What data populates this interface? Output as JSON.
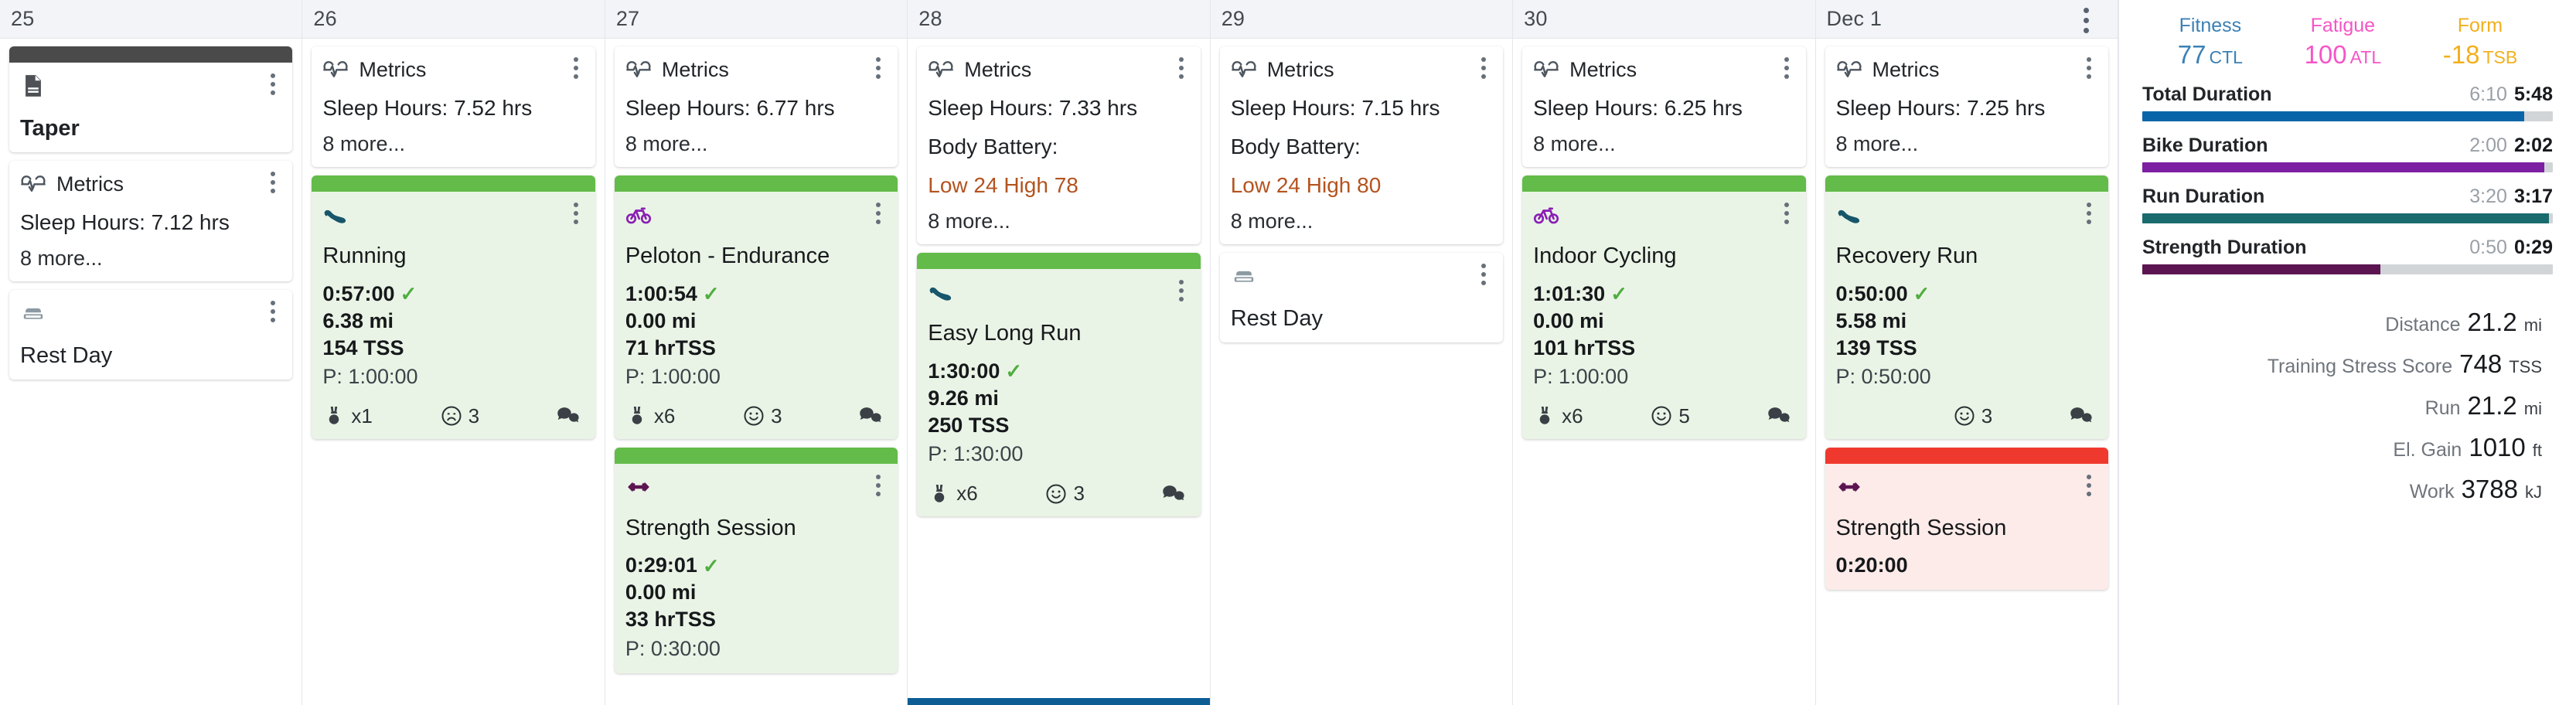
{
  "colors": {
    "completed_strip": "#63bb49",
    "completed_bg": "#eaf4e6",
    "missed_strip": "#f0392e",
    "missed_bg": "#fcebe9",
    "note_strip": "#4a4a4a",
    "fitness": "#3b80b5",
    "fatigue": "#f555c8",
    "form": "#f2b01e",
    "total_bar": "#0a65a8",
    "bike_bar": "#7c1fa2",
    "run_bar": "#1a6b6e",
    "strength_bar": "#5c1551",
    "bar_track": "#d2d5d8",
    "today_bar": "#0d5d95",
    "alert_text": "#b4531f"
  },
  "days": [
    {
      "label": "25",
      "today": false,
      "cards": [
        {
          "kind": "note",
          "icon": "document-icon",
          "title": "Taper",
          "strip": "note"
        },
        {
          "kind": "metrics",
          "icon": "heartbeat-icon",
          "source": "Metrics",
          "lines": [
            {
              "text": "Sleep Hours: 7.12 hrs",
              "alert": false
            }
          ],
          "more": "8 more..."
        },
        {
          "kind": "rest",
          "icon": "rest-day-icon",
          "title": "Rest Day"
        }
      ]
    },
    {
      "label": "26",
      "today": false,
      "cards": [
        {
          "kind": "metrics",
          "icon": "heartbeat-icon",
          "source": "Metrics",
          "lines": [
            {
              "text": "Sleep Hours: 7.52 hrs",
              "alert": false
            }
          ],
          "more": "8 more..."
        },
        {
          "kind": "workout",
          "status": "completed",
          "icon": "running-shoe-icon",
          "title": "Running",
          "duration": "0:57:00",
          "completed_check": true,
          "distance": "6.38 mi",
          "tss": "154 TSS",
          "planned": "P: 1:00:00",
          "footer": {
            "medal": "x1",
            "mood_icon": "frowning-face-icon",
            "mood": "3",
            "comments_icon": "comment-bubbles-icon"
          }
        }
      ]
    },
    {
      "label": "27",
      "today": false,
      "cards": [
        {
          "kind": "metrics",
          "icon": "heartbeat-icon",
          "source": "Metrics",
          "lines": [
            {
              "text": "Sleep Hours: 6.77 hrs",
              "alert": false
            }
          ],
          "more": "8 more..."
        },
        {
          "kind": "workout",
          "status": "completed",
          "icon": "bicycle-icon",
          "title": "Peloton - Endurance",
          "duration": "1:00:54",
          "completed_check": true,
          "distance": "0.00 mi",
          "tss": "71 hrTSS",
          "planned": "P: 1:00:00",
          "footer": {
            "medal": "x6",
            "mood_icon": "smiling-face-icon",
            "mood": "3",
            "comments_icon": "comment-bubbles-icon"
          }
        },
        {
          "kind": "workout",
          "status": "completed",
          "icon": "dumbbell-icon",
          "title": "Strength Session",
          "duration": "0:29:01",
          "completed_check": true,
          "distance": "0.00 mi",
          "tss": "33 hrTSS",
          "planned": "P: 0:30:00",
          "footer": null
        }
      ]
    },
    {
      "label": "28",
      "today": true,
      "cards": [
        {
          "kind": "metrics",
          "icon": "heartbeat-icon",
          "source": "Metrics",
          "lines": [
            {
              "text": "Sleep Hours: 7.33 hrs",
              "alert": false
            },
            {
              "text": "Body Battery:",
              "alert": false
            },
            {
              "text": "Low 24 High 78",
              "alert": true
            }
          ],
          "more": "8 more..."
        },
        {
          "kind": "workout",
          "status": "completed",
          "icon": "running-shoe-icon",
          "title": "Easy Long Run",
          "duration": "1:30:00",
          "completed_check": true,
          "distance": "9.26 mi",
          "tss": "250 TSS",
          "planned": "P: 1:30:00",
          "footer": {
            "medal": "x6",
            "mood_icon": "smiling-face-icon",
            "mood": "3",
            "comments_icon": "comment-bubbles-icon"
          }
        }
      ]
    },
    {
      "label": "29",
      "today": false,
      "cards": [
        {
          "kind": "metrics",
          "icon": "heartbeat-icon",
          "source": "Metrics",
          "lines": [
            {
              "text": "Sleep Hours: 7.15 hrs",
              "alert": false
            },
            {
              "text": "Body Battery:",
              "alert": false
            },
            {
              "text": "Low 24 High 80",
              "alert": true
            }
          ],
          "more": "8 more..."
        },
        {
          "kind": "rest",
          "icon": "rest-day-icon",
          "title": "Rest Day"
        }
      ]
    },
    {
      "label": "30",
      "today": false,
      "cards": [
        {
          "kind": "metrics",
          "icon": "heartbeat-icon",
          "source": "Metrics",
          "lines": [
            {
              "text": "Sleep Hours: 6.25 hrs",
              "alert": false
            }
          ],
          "more": "8 more..."
        },
        {
          "kind": "workout",
          "status": "completed",
          "icon": "bicycle-icon",
          "title": "Indoor Cycling",
          "duration": "1:01:30",
          "completed_check": true,
          "distance": "0.00 mi",
          "tss": "101 hrTSS",
          "planned": "P: 1:00:00",
          "footer": {
            "medal": "x6",
            "mood_icon": "smiling-face-icon",
            "mood": "5",
            "comments_icon": "comment-bubbles-icon"
          }
        }
      ]
    },
    {
      "label": "Dec 1",
      "today": false,
      "cards": [
        {
          "kind": "metrics",
          "icon": "heartbeat-icon",
          "source": "Metrics",
          "lines": [
            {
              "text": "Sleep Hours: 7.25 hrs",
              "alert": false
            }
          ],
          "more": "8 more..."
        },
        {
          "kind": "workout",
          "status": "completed",
          "icon": "running-shoe-icon",
          "title": "Recovery Run",
          "duration": "0:50:00",
          "completed_check": true,
          "distance": "5.58 mi",
          "tss": "139 TSS",
          "planned": "P: 0:50:00",
          "footer": {
            "medal": null,
            "mood_icon": "smiling-face-icon",
            "mood": "3",
            "comments_icon": "comment-bubbles-icon"
          }
        },
        {
          "kind": "workout",
          "status": "missed",
          "icon": "dumbbell-icon",
          "title": "Strength Session",
          "duration": "0:20:00",
          "completed_check": false,
          "distance": null,
          "tss": null,
          "planned": null,
          "footer": null
        }
      ]
    }
  ],
  "summary": {
    "chips": [
      {
        "name": "Fitness",
        "value": "77",
        "unit": "CTL",
        "color_key": "fitness"
      },
      {
        "name": "Fatigue",
        "value": "100",
        "unit": "ATL",
        "color_key": "fatigue"
      },
      {
        "name": "Form",
        "value": "-18",
        "unit": "TSB",
        "color_key": "form"
      }
    ],
    "durations": [
      {
        "label": "Total Duration",
        "planned": "6:10",
        "actual": "5:48",
        "pct": 93,
        "color_key": "total_bar"
      },
      {
        "label": "Bike Duration",
        "planned": "2:00",
        "actual": "2:02",
        "pct": 98,
        "color_key": "bike_bar"
      },
      {
        "label": "Run Duration",
        "planned": "3:20",
        "actual": "3:17",
        "pct": 99,
        "color_key": "run_bar"
      },
      {
        "label": "Strength Duration",
        "planned": "0:50",
        "actual": "0:29",
        "pct": 58,
        "color_key": "strength_bar"
      }
    ],
    "stats": [
      {
        "name": "Distance",
        "value": "21.2",
        "unit": "mi"
      },
      {
        "name": "Training Stress Score",
        "value": "748",
        "unit": "TSS"
      },
      {
        "name": "Run",
        "value": "21.2",
        "unit": "mi"
      },
      {
        "name": "El. Gain",
        "value": "1010",
        "unit": "ft"
      },
      {
        "name": "Work",
        "value": "3788",
        "unit": "kJ"
      }
    ]
  }
}
